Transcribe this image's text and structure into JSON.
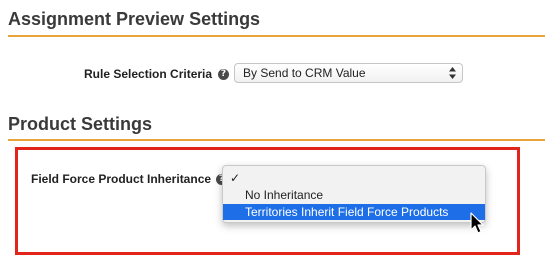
{
  "assignment_preview": {
    "title": "Assignment Preview Settings",
    "rule_selection": {
      "label": "Rule Selection Criteria",
      "help_icon": "question-circle-icon",
      "selected_value": "By Send to CRM Value"
    }
  },
  "product_settings": {
    "title": "Product Settings",
    "product_inheritance": {
      "label": "Field Force Product Inheritance",
      "help_icon": "question-circle-icon",
      "options": [
        {
          "label": "",
          "checked": true
        },
        {
          "label": "No Inheritance",
          "checked": false
        },
        {
          "label": "Territories Inherit Field Force Products",
          "checked": false,
          "hovered": true
        }
      ]
    }
  },
  "colors": {
    "accent_rule": "#e8a33d",
    "highlight_frame": "#e1251b",
    "option_highlight": "#1e6ee8"
  }
}
